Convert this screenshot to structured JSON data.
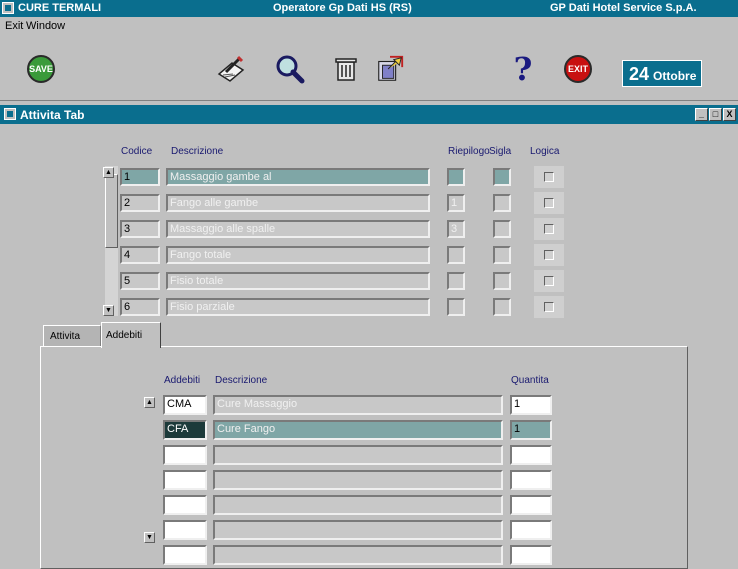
{
  "titlebar": {
    "app_title": "CURE TERMALI",
    "operator": "Operatore Gp Dati HS (RS)",
    "company": "GP Dati Hotel Service S.p.A."
  },
  "menu": {
    "exit": "Exit",
    "window": "Window"
  },
  "toolbar": {
    "save_label": "SAVE",
    "exit_label": "EXIT",
    "help_label": "?",
    "date_day": "24",
    "date_month": "Ottobre",
    "icons": [
      "save-icon",
      "edit-icon",
      "search-icon",
      "trash-icon",
      "export-icon",
      "help-icon",
      "exit-icon"
    ]
  },
  "window": {
    "title": "Attivita Tab",
    "controls": [
      "_",
      "□",
      "X"
    ]
  },
  "activities": {
    "headers": {
      "codice": "Codice",
      "descrizione": "Descrizione",
      "riepilogo": "Riepilogo",
      "sigla": "Sigla",
      "logica": "Logica"
    },
    "rows": [
      {
        "codice": "1",
        "descrizione": "Massaggio gambe al",
        "riepilogo": "",
        "sigla": "",
        "logica": false,
        "selected": true
      },
      {
        "codice": "2",
        "descrizione": "Fango alle gambe",
        "riepilogo": "1",
        "sigla": "",
        "logica": false,
        "selected": false
      },
      {
        "codice": "3",
        "descrizione": "Massaggio alle spalle",
        "riepilogo": "3",
        "sigla": "",
        "logica": false,
        "selected": false
      },
      {
        "codice": "4",
        "descrizione": "Fango totale",
        "riepilogo": "",
        "sigla": "",
        "logica": false,
        "selected": false
      },
      {
        "codice": "5",
        "descrizione": "Fisio totale",
        "riepilogo": "",
        "sigla": "",
        "logica": false,
        "selected": false
      },
      {
        "codice": "6",
        "descrizione": "Fisio parziale",
        "riepilogo": "",
        "sigla": "",
        "logica": false,
        "selected": false
      }
    ]
  },
  "tabs": {
    "attivita": "Attivita",
    "addebiti": "Addebiti",
    "active": "addebiti"
  },
  "charges": {
    "headers": {
      "addebiti": "Addebiti",
      "descrizione": "Descrizione",
      "quantita": "Quantita"
    },
    "rows": [
      {
        "code": "CMA",
        "descrizione": "Cure Massaggio",
        "quantita": "1"
      },
      {
        "code": "CFA",
        "descrizione": "Cure Fango",
        "quantita": "1"
      },
      {
        "code": "",
        "descrizione": "",
        "quantita": ""
      },
      {
        "code": "",
        "descrizione": "",
        "quantita": ""
      },
      {
        "code": "",
        "descrizione": "",
        "quantita": ""
      },
      {
        "code": "",
        "descrizione": "",
        "quantita": ""
      },
      {
        "code": "",
        "descrizione": "",
        "quantita": ""
      }
    ]
  }
}
